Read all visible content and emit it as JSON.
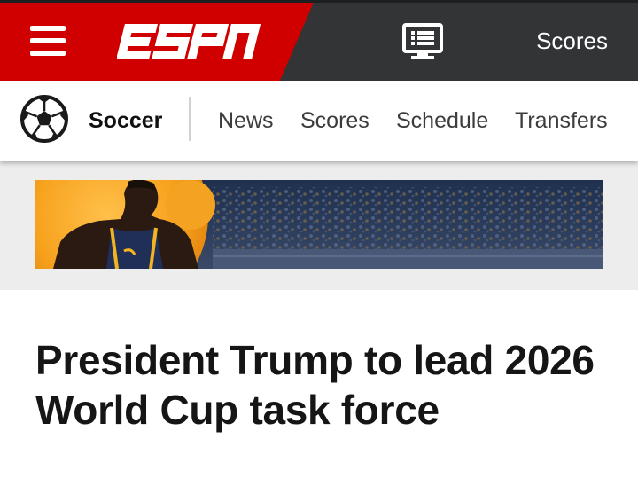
{
  "header": {
    "brand": "ESPN",
    "scores_label": "Scores",
    "colors": {
      "brand_red": "#d00000",
      "bar_dark": "#333436"
    }
  },
  "icons": {
    "menu": "hamburger-menu-icon",
    "tv": "tv-guide-icon",
    "sport": "soccer-ball-icon"
  },
  "subnav": {
    "sport": "Soccer",
    "items": [
      {
        "label": "News"
      },
      {
        "label": "Scores"
      },
      {
        "label": "Schedule"
      },
      {
        "label": "Transfers"
      }
    ]
  },
  "article": {
    "headline": "President Trump to lead 2026 World Cup task force"
  }
}
